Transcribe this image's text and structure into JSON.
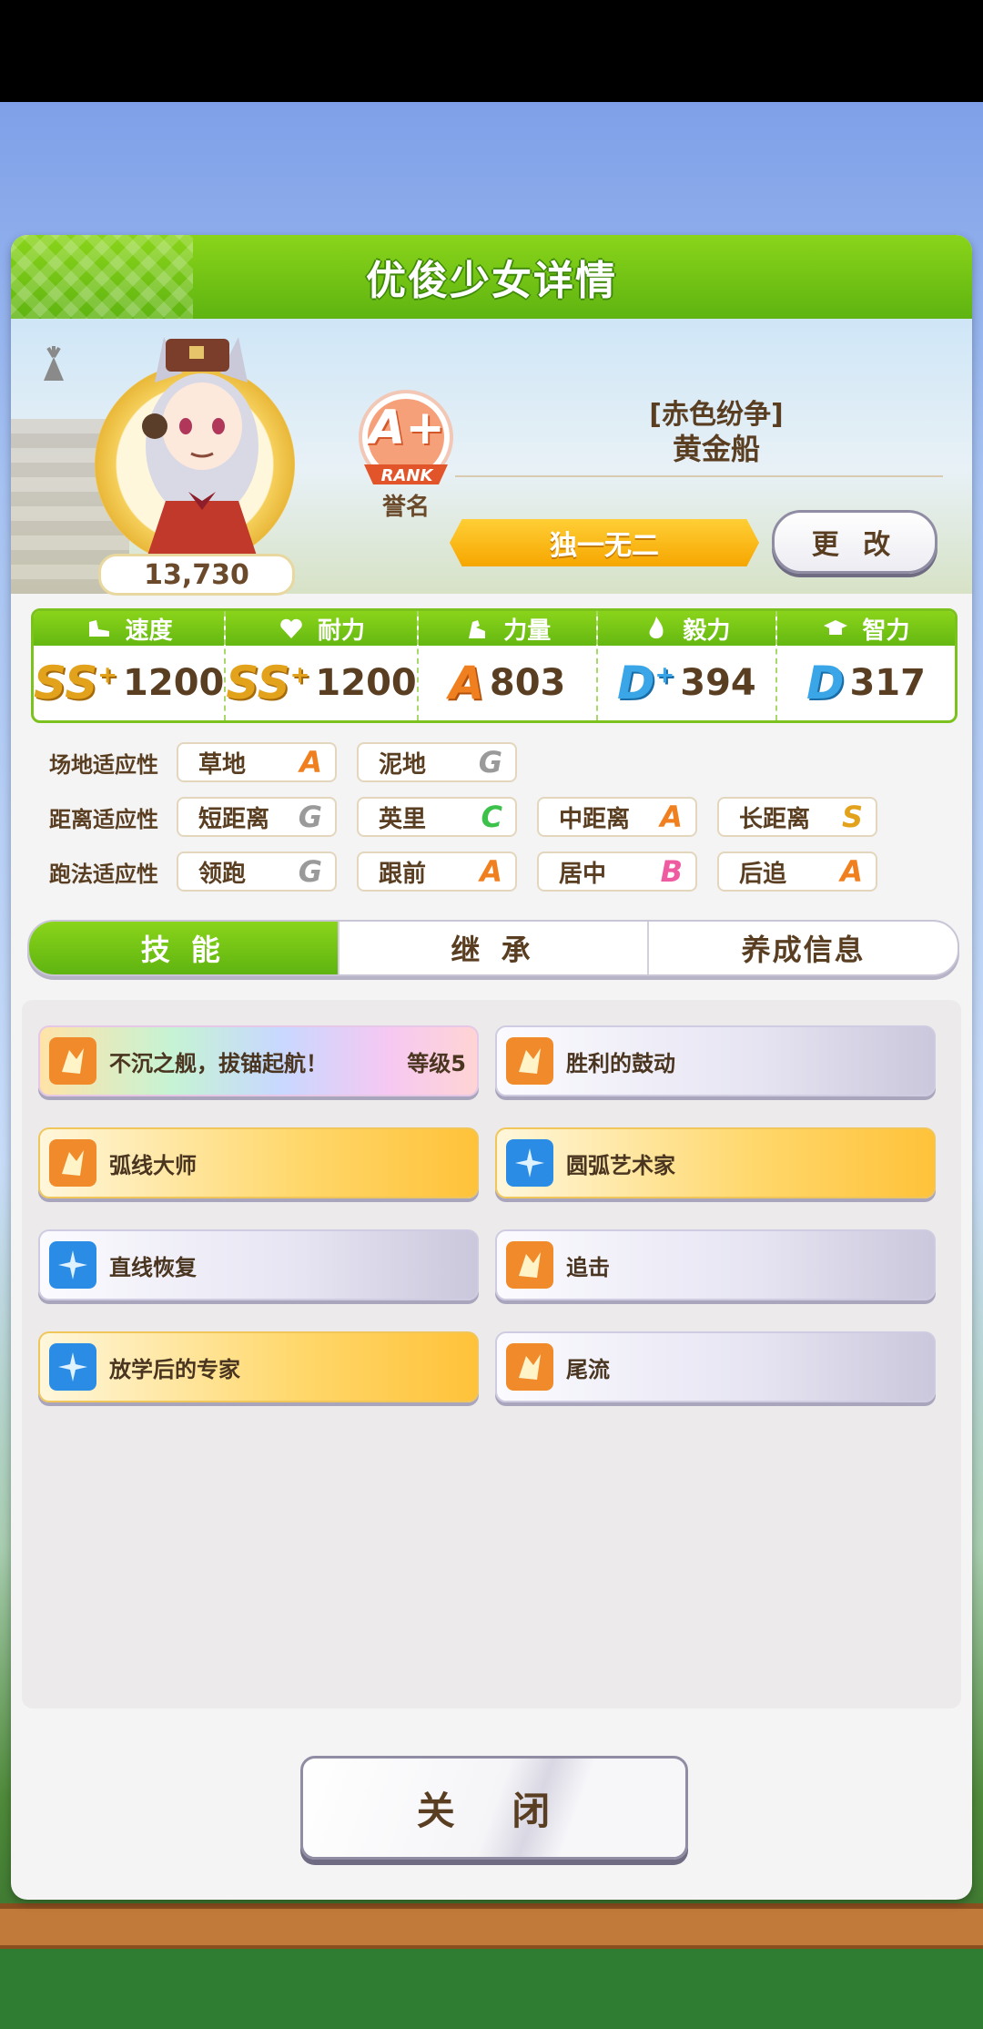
{
  "header": {
    "title": "优俊少女详情"
  },
  "profile": {
    "score": "13,730",
    "rank_grade": "A+",
    "rank_word": "RANK",
    "rank_label": "誉名",
    "epithet": "[赤色纷争]",
    "name": "黄金船",
    "title_banner": "独一无二",
    "change_label": "更 改"
  },
  "stats": [
    {
      "label": "速度",
      "grade": "SS",
      "plus": "+",
      "value": "1200",
      "icon": "shoe-icon"
    },
    {
      "label": "耐力",
      "grade": "SS",
      "plus": "+",
      "value": "1200",
      "icon": "heart-icon"
    },
    {
      "label": "力量",
      "grade": "A",
      "plus": "",
      "value": "803",
      "icon": "muscle-icon"
    },
    {
      "label": "毅力",
      "grade": "D",
      "plus": "+",
      "value": "394",
      "icon": "flame-icon"
    },
    {
      "label": "智力",
      "grade": "D",
      "plus": "",
      "value": "317",
      "icon": "graduation-cap-icon"
    }
  ],
  "aptitude": {
    "surface": {
      "label": "场地适应性",
      "items": [
        {
          "name": "草地",
          "grade": "A"
        },
        {
          "name": "泥地",
          "grade": "G"
        }
      ]
    },
    "distance": {
      "label": "距离适应性",
      "items": [
        {
          "name": "短距离",
          "grade": "G"
        },
        {
          "name": "英里",
          "grade": "C"
        },
        {
          "name": "中距离",
          "grade": "A"
        },
        {
          "name": "长距离",
          "grade": "S"
        }
      ]
    },
    "strategy": {
      "label": "跑法适应性",
      "items": [
        {
          "name": "领跑",
          "grade": "G"
        },
        {
          "name": "跟前",
          "grade": "A"
        },
        {
          "name": "居中",
          "grade": "B"
        },
        {
          "name": "后追",
          "grade": "A"
        }
      ]
    }
  },
  "tabs": [
    "技 能",
    "继 承",
    "养成信息"
  ],
  "skills": [
    {
      "name": "不沉之舰，拔锚起航！",
      "level": "等级5",
      "style": "rainbow",
      "icon": "orange"
    },
    {
      "name": "胜利的鼓动",
      "level": "",
      "style": "grey",
      "icon": "orange"
    },
    {
      "name": "弧线大师",
      "level": "",
      "style": "gold",
      "icon": "orange"
    },
    {
      "name": "圆弧艺术家",
      "level": "",
      "style": "gold",
      "icon": "blue"
    },
    {
      "name": "直线恢复",
      "level": "",
      "style": "grey",
      "icon": "blue"
    },
    {
      "name": "追击",
      "level": "",
      "style": "grey",
      "icon": "orange"
    },
    {
      "name": "放学后的专家",
      "level": "",
      "style": "gold",
      "icon": "blue"
    },
    {
      "name": "尾流",
      "level": "",
      "style": "grey",
      "icon": "orange"
    }
  ],
  "close_label": "关 闭",
  "colors": {
    "accent_green": "#6cc416",
    "brown_text": "#5a3e22",
    "gold": "#f6a600"
  }
}
